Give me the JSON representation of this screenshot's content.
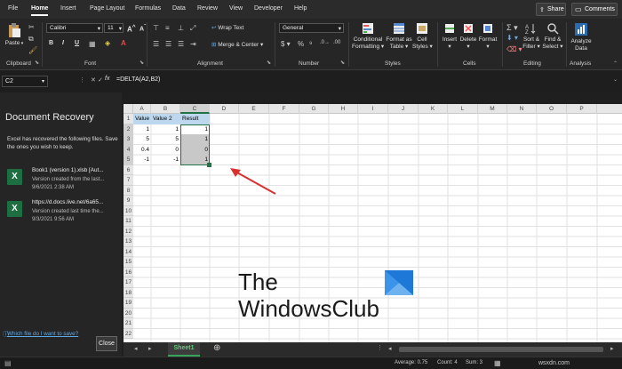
{
  "tabs": [
    "File",
    "Home",
    "Insert",
    "Page Layout",
    "Formulas",
    "Data",
    "Review",
    "View",
    "Developer",
    "Help"
  ],
  "share_label": "Share",
  "comments_label": "Comments",
  "ribbon": {
    "paste": "Paste",
    "font_name": "Calibri",
    "font_size": "11",
    "bold": "B",
    "italic": "I",
    "underline": "U",
    "wrap_text": "Wrap Text",
    "merge_center": "Merge & Center",
    "number_format": "General",
    "cond_format": [
      "Conditional",
      "Formatting"
    ],
    "format_table": [
      "Format as",
      "Table"
    ],
    "cell_styles": [
      "Cell",
      "Styles"
    ],
    "insert": "Insert",
    "delete": "Delete",
    "format": "Format",
    "sort_filter": [
      "Sort &",
      "Filter"
    ],
    "find_select": [
      "Find &",
      "Select"
    ],
    "analyze_data": [
      "Analyze",
      "Data"
    ],
    "groups": [
      "Clipboard",
      "Font",
      "Alignment",
      "Number",
      "Styles",
      "Cells",
      "Editing",
      "Analysis"
    ]
  },
  "name_box": "C2",
  "fx": "fx",
  "formula": "=DELTA(A2,B2)",
  "recovery": {
    "title": "Document Recovery",
    "message": "Excel has recovered the following files.  Save the ones you wish to keep.",
    "files": [
      {
        "name": "Book1 (version 1).xlsb  [Aut...",
        "desc1": "Version created from the last...",
        "desc2": "9/6/2021 2:38 AM"
      },
      {
        "name": "https://d.docs.live.net/6a65...",
        "desc1": "Version created last time the...",
        "desc2": "9/3/2021 9:56 AM"
      }
    ],
    "which_link": "Which file do I want to save?",
    "close": "Close"
  },
  "columns": [
    "A",
    "B",
    "C",
    "D",
    "E",
    "F",
    "G",
    "H",
    "I",
    "J",
    "K",
    "L",
    "M",
    "N",
    "O",
    "P"
  ],
  "rows": [
    "1",
    "2",
    "3",
    "4",
    "5",
    "6",
    "7",
    "8",
    "9",
    "10",
    "11",
    "12",
    "13",
    "14",
    "15",
    "16",
    "17",
    "18",
    "19",
    "20",
    "21",
    "22"
  ],
  "headers": [
    "Value 1",
    "Value 2",
    "Result"
  ],
  "data": [
    [
      "1",
      "1",
      "1"
    ],
    [
      "5",
      "5",
      "1"
    ],
    [
      "0.4",
      "0",
      "0"
    ],
    [
      "-1",
      "-1",
      "1"
    ]
  ],
  "sheet_tab": "Sheet1",
  "status": {
    "average": "Average: 0.75",
    "count": "Count: 4",
    "sum": "Sum: 3"
  },
  "watermark": {
    "line1": "The",
    "line2": "WindowsClub"
  },
  "site": "wsxdn.com"
}
